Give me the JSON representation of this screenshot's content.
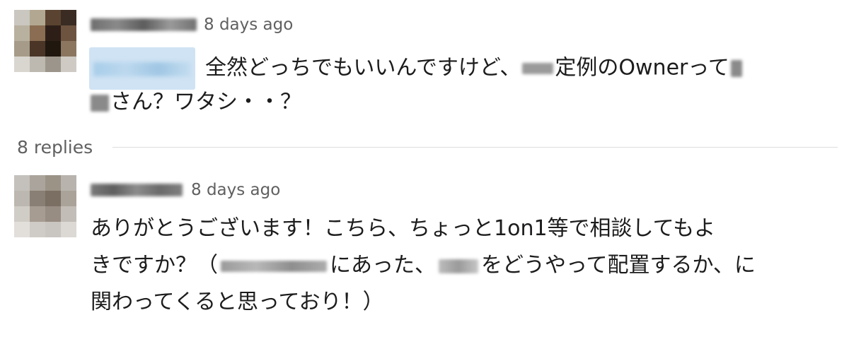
{
  "thread": {
    "parent": {
      "avatar_colors": [
        [
          "#c9c7bf",
          "#b2a892",
          "#5a4330",
          "#3a2c22"
        ],
        [
          "#b8b1a0",
          "#8a6d52",
          "#2d1f18",
          "#6d5440"
        ],
        [
          "#a69b88",
          "#4a3527",
          "#20170f",
          "#8c7660"
        ],
        [
          "#d9d6d0",
          "#bdb8b0",
          "#9c958b",
          "#cfcbc4"
        ]
      ],
      "timestamp": "8 days ago",
      "text_line1": "全然どっちでもいいんですけど、",
      "text_line1b": "定例のOwnerって",
      "text_line2": "さん？ワタシ・・？"
    },
    "replies_count_label": "8 replies",
    "reply": {
      "avatar_colors": [
        [
          "#c4c1bc",
          "#aaa49c",
          "#9c9387",
          "#b8b3ac"
        ],
        [
          "#bcb7b0",
          "#8a7f74",
          "#7b6f64",
          "#aaa39a"
        ],
        [
          "#d0ccc6",
          "#a79c92",
          "#988d83",
          "#c2bdb6"
        ],
        [
          "#e2dfdb",
          "#cfcbc6",
          "#c9c5c0",
          "#dcd9d5"
        ]
      ],
      "timestamp": "8 days ago",
      "text_line1": "ありがとうございます！こちら、ちょっと1on1等で相談してもよ",
      "text_line2a": "きですか？（",
      "text_line2b": "にあった、",
      "text_line2c": "をどうやって配置するか、に",
      "text_line3": "関わってくると思っており！）"
    }
  }
}
